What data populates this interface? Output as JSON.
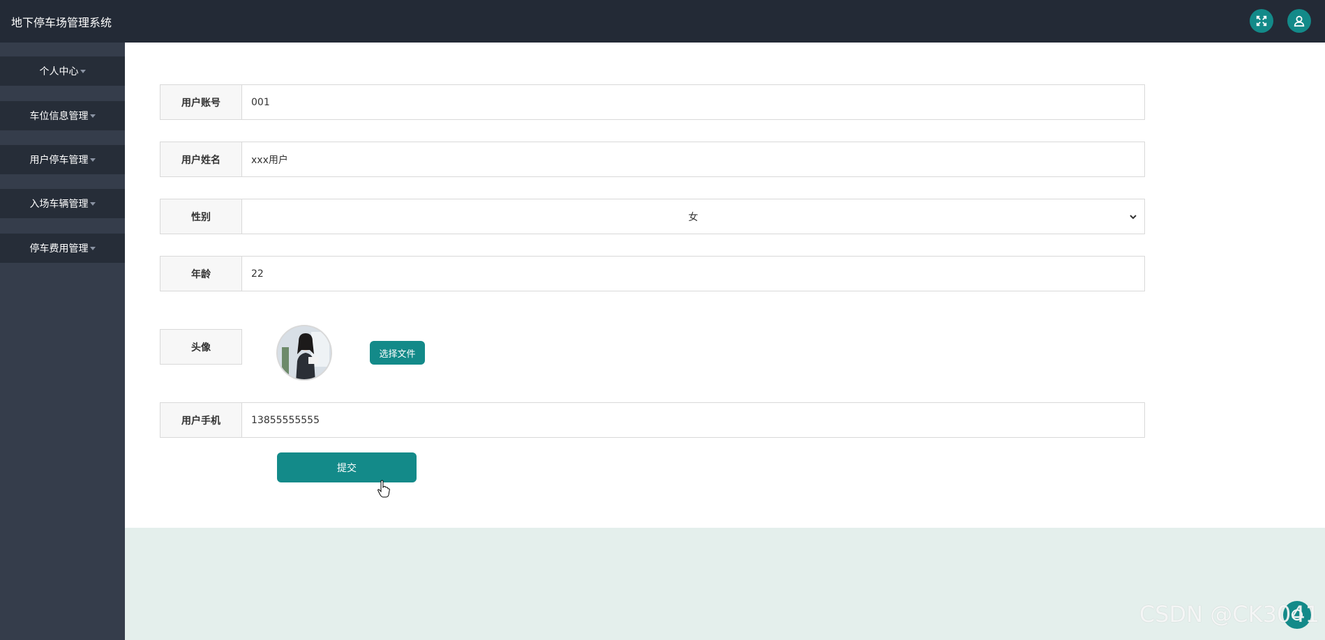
{
  "app": {
    "title": "地下停车场管理系统"
  },
  "header": {
    "fullscreen_icon": "fullscreen-icon",
    "user_icon": "user-icon"
  },
  "sidebar": {
    "items": [
      {
        "label": "个人中心"
      },
      {
        "label": "车位信息管理"
      },
      {
        "label": "用户停车管理"
      },
      {
        "label": "入场车辆管理"
      },
      {
        "label": "停车费用管理"
      }
    ]
  },
  "form": {
    "account": {
      "label": "用户账号",
      "value": "001"
    },
    "name": {
      "label": "用户姓名",
      "value": "xxx用户"
    },
    "gender": {
      "label": "性别",
      "value": "女"
    },
    "age": {
      "label": "年龄",
      "value": "22"
    },
    "avatar": {
      "label": "头像",
      "upload_label": "选择文件"
    },
    "phone": {
      "label": "用户手机",
      "value": "13855555555"
    },
    "submit_label": "提交"
  },
  "watermark": "CSDN @CK3041",
  "colors": {
    "accent": "#138a89",
    "topbar": "#232a36",
    "sidebar": "#353d4b",
    "menu_item": "#262d38",
    "footer_bg": "#e4efec"
  }
}
